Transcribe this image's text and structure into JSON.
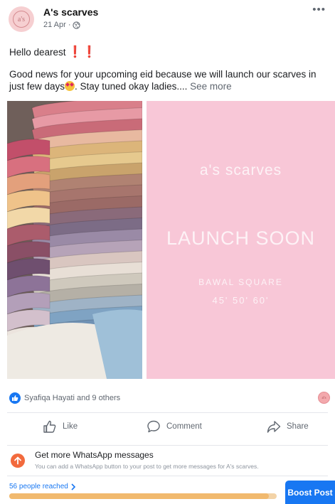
{
  "post": {
    "page_name": "A's scarves",
    "avatar_text": "a's",
    "date": "21 Apr",
    "separator": "·",
    "more": "•••",
    "line1": "Hello dearest",
    "line2_a": "Good news for your upcoming eid because we will launch our scarves in just few days",
    "line2_b": ". Stay tuned okay ladies....",
    "see_more": "See more"
  },
  "image": {
    "brand": "a's scarves",
    "headline": "LAUNCH SOON",
    "product": "BAWAL SQUARE",
    "sizes": "45' 50' 60'",
    "colors": {
      "pink_panel": "#f8c7d7"
    }
  },
  "reactions": {
    "summary": "Syafiqa Hayati and 9 others"
  },
  "actions": {
    "like": "Like",
    "comment": "Comment",
    "share": "Share"
  },
  "whatsapp": {
    "title": "Get more WhatsApp messages",
    "subtitle": "You can add a WhatsApp button to your post to get more messages for A's scarves."
  },
  "reach": {
    "label": "56 people reached",
    "progress": 0.97
  },
  "boost": {
    "label": "Boost Post"
  },
  "colors": {
    "accent": "#1877f2",
    "whatsapp_icon": "#f26a3d"
  }
}
